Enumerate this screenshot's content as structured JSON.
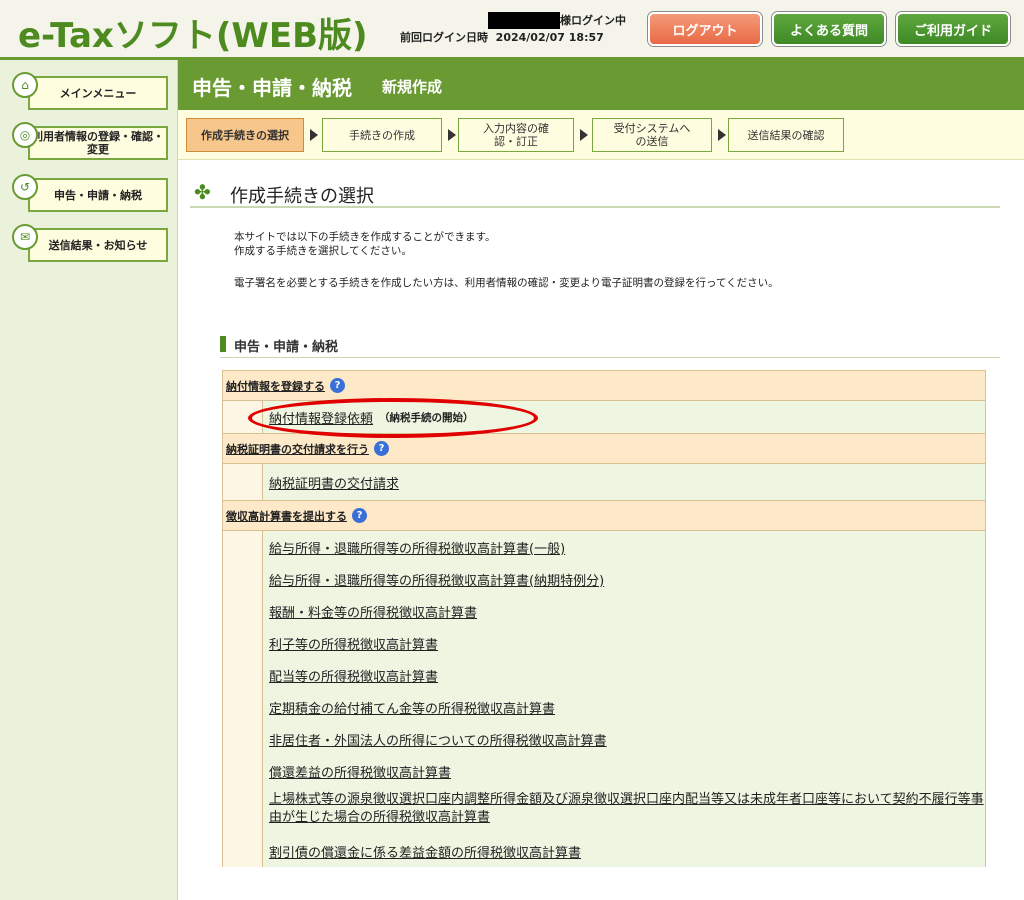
{
  "header": {
    "logo": "e-Taxソフト(WEB版)",
    "login_status": "様ログイン中",
    "last_login_label": "前回ログイン日時",
    "last_login_value": "2024/02/07 18:57",
    "logout_label": "ログアウト",
    "faq_label": "よくある質問",
    "guide_label": "ご利用ガイド",
    "colors": {
      "brand": "#4d8a1f",
      "logout": "#e86a45"
    }
  },
  "sidebar": {
    "items": [
      {
        "label": "メインメニュー",
        "icon": "home-icon"
      },
      {
        "label": "利用者情報の登録・確認・変更",
        "icon": "user-info-icon"
      },
      {
        "label": "申告・申請・納税",
        "icon": "document-icon"
      },
      {
        "label": "送信結果・お知らせ",
        "icon": "mail-icon"
      }
    ]
  },
  "titlebar": {
    "title": "申告・申請・納税",
    "subtitle": "新規作成"
  },
  "steps": [
    {
      "label": "作成手続きの選択",
      "active": true
    },
    {
      "label": "手続きの作成",
      "active": false
    },
    {
      "label": "入力内容の確認・訂正",
      "active": false
    },
    {
      "label": "受付システムへの送信",
      "active": false
    },
    {
      "label": "送信結果の確認",
      "active": false
    }
  ],
  "main": {
    "section_title": "作成手続きの選択",
    "desc_line1": "本サイトでは以下の手続きを作成することができます。",
    "desc_line2": "作成する手続きを選択してください。",
    "desc_line3": "電子署名を必要とする手続きを作成したい方は、利用者情報の確認・変更より電子証明書の登録を行ってください。",
    "sub_heading": "申告・申請・納税",
    "groups": [
      {
        "label": "納付情報を登録する",
        "items": [
          {
            "text": "納付情報登録依頼",
            "note": "（納税手続の開始）"
          }
        ]
      },
      {
        "label": "納税証明書の交付請求を行う",
        "items": [
          {
            "text": "納税証明書の交付請求"
          }
        ]
      },
      {
        "label": "徴収高計算書を提出する",
        "items": [
          {
            "text": "給与所得・退職所得等の所得税徴収高計算書(一般)"
          },
          {
            "text": "給与所得・退職所得等の所得税徴収高計算書(納期特例分)"
          },
          {
            "text": "報酬・料金等の所得税徴収高計算書"
          },
          {
            "text": "利子等の所得税徴収高計算書"
          },
          {
            "text": "配当等の所得税徴収高計算書"
          },
          {
            "text": "定期積金の給付補てん金等の所得税徴収高計算書"
          },
          {
            "text": "非居住者・外国法人の所得についての所得税徴収高計算書"
          },
          {
            "text": "償還差益の所得税徴収高計算書"
          },
          {
            "text": "上場株式等の源泉徴収選択口座内調整所得金額及び源泉徴収選択口座内配当等又は未成年者口座等において契約不履行等事由が生じた場合の所得税徴収高計算書"
          },
          {
            "text": "割引債の償還金に係る差益金額の所得税徴収高計算書"
          }
        ]
      }
    ]
  }
}
